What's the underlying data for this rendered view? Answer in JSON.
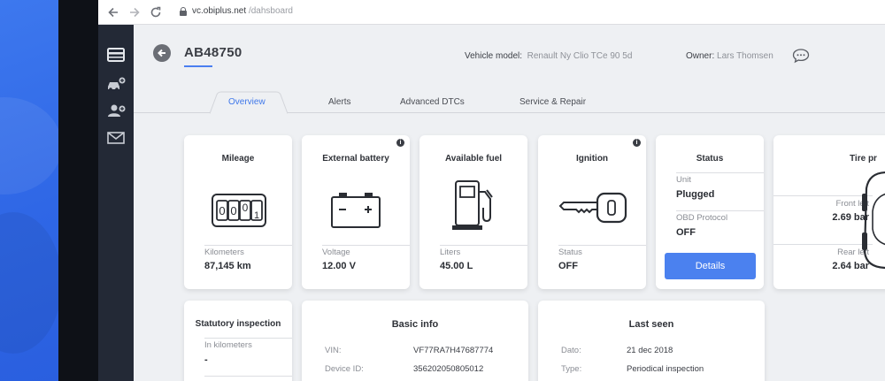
{
  "browser": {
    "url_host": "vc.obiplus.net",
    "url_path": "/dahsboard",
    "nav_icons": [
      "back-arrow-icon",
      "forward-arrow-icon",
      "reload-icon",
      "lock-icon"
    ]
  },
  "sidebar": {
    "items": [
      {
        "icon": "dashboard-card-icon"
      },
      {
        "icon": "add-vehicle-icon"
      },
      {
        "icon": "add-user-icon"
      },
      {
        "icon": "mail-icon"
      }
    ]
  },
  "header": {
    "vehicle_id": "AB48750",
    "model_label": "Vehicle model:",
    "model_value": "Renault Ny Clio TCe 90 5d",
    "owner_label": "Owner:",
    "owner_value": "Lars Thomsen"
  },
  "tabs": [
    {
      "label": "Overview",
      "active": true
    },
    {
      "label": "Alerts",
      "active": false
    },
    {
      "label": "Advanced DTCs",
      "active": false
    },
    {
      "label": "Service & Repair",
      "active": false
    }
  ],
  "cards": {
    "mileage": {
      "title": "Mileage",
      "label": "Kilometers",
      "value": "87,145 km",
      "odometer_digits": [
        "0",
        "0",
        "0",
        "1"
      ]
    },
    "battery": {
      "title": "External battery",
      "label": "Voltage",
      "value": "12.00 V"
    },
    "fuel": {
      "title": "Available fuel",
      "label": "Liters",
      "value": "45.00 L"
    },
    "ignition": {
      "title": "Ignition",
      "label": "Status",
      "value": "OFF"
    },
    "status": {
      "title": "Status",
      "unit_label": "Unit",
      "unit_value": "Plugged",
      "obd_label": "OBD Protocol",
      "obd_value": "OFF",
      "button": "Details"
    },
    "tire": {
      "title": "Tire pr",
      "front_left_label": "Front left",
      "front_left_value": "2.69 bar",
      "rear_left_label": "Rear left",
      "rear_left_value": "2.64 bar"
    },
    "statutory": {
      "title": "Statutory inspection",
      "label": "In kilometers",
      "value": "-"
    },
    "basic_info": {
      "title": "Basic info",
      "vin_label": "VIN:",
      "vin_value": "VF77RA7H47687774",
      "device_label": "Device ID:",
      "device_value": "356202050805012"
    },
    "last_seen": {
      "title": "Last seen",
      "date_label": "Dato:",
      "date_value": "21 dec 2018",
      "type_label": "Type:",
      "type_value": "Periodical inspection"
    }
  },
  "info_badge": "i",
  "colors": {
    "accent": "#4b81ef",
    "sidebar": "#232936",
    "desktop": "#3370e8"
  }
}
